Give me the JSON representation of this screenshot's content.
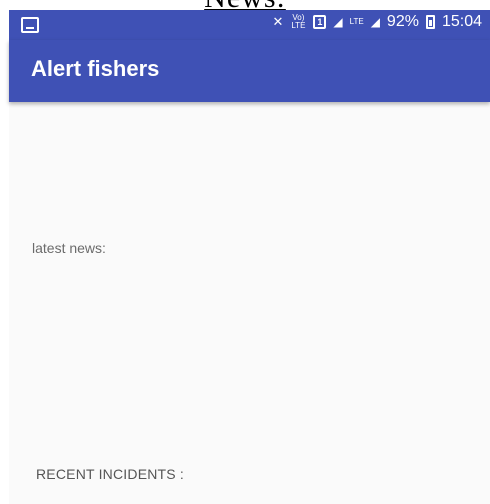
{
  "overlay": {
    "title": "News:"
  },
  "status_bar": {
    "volte": "Vo) LTE",
    "sim": "1",
    "lte": "LTE",
    "battery": "92%",
    "time": "15:04"
  },
  "app_bar": {
    "title": "Alert fishers"
  },
  "content": {
    "latest_news_label": "latest news:",
    "recent_incidents_label": "RECENT INCIDENTS :"
  }
}
